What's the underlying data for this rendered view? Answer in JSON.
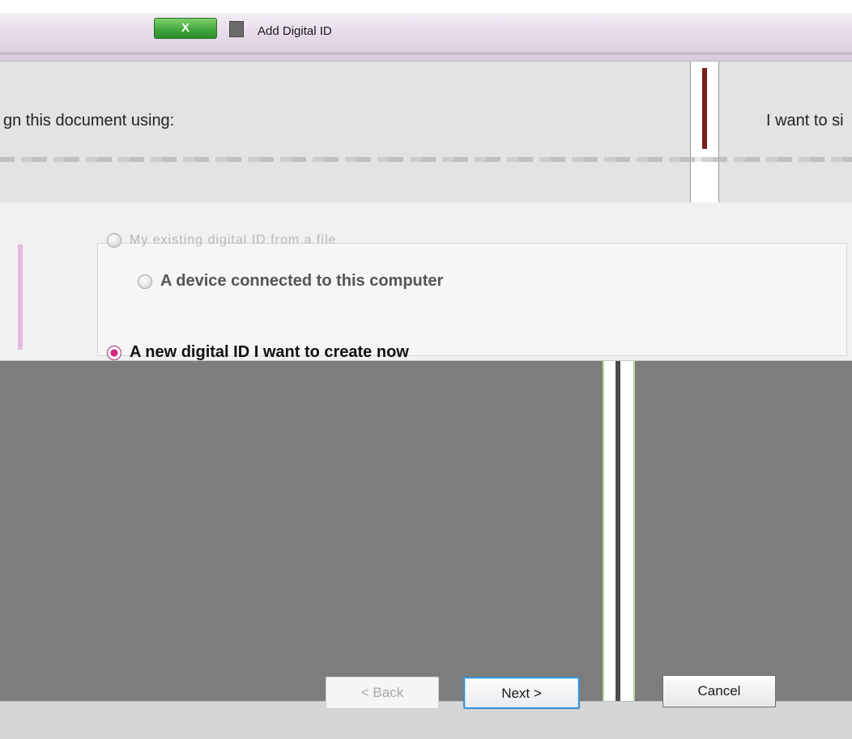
{
  "window": {
    "title": "Add Digital ID",
    "close_label": "X"
  },
  "upper": {
    "sign_label": "gn this document using:",
    "want_label": "I want to si"
  },
  "options": {
    "items": [
      {
        "label": "My existing digital ID from a file",
        "checked": false,
        "style": "ghost"
      },
      {
        "label": "A device connected to this computer",
        "checked": false,
        "style": "muted"
      },
      {
        "label": "A new digital ID I want to create now",
        "checked": true,
        "style": "strong"
      }
    ]
  },
  "footer": {
    "back_label": "< Back",
    "next_label": "Next >",
    "cancel_label": "Cancel"
  },
  "colors": {
    "accent": "#3c8fd1",
    "radio_selected": "#d3267f",
    "banner_text": "#cc1f1f",
    "close_button": "#3fa53a"
  }
}
